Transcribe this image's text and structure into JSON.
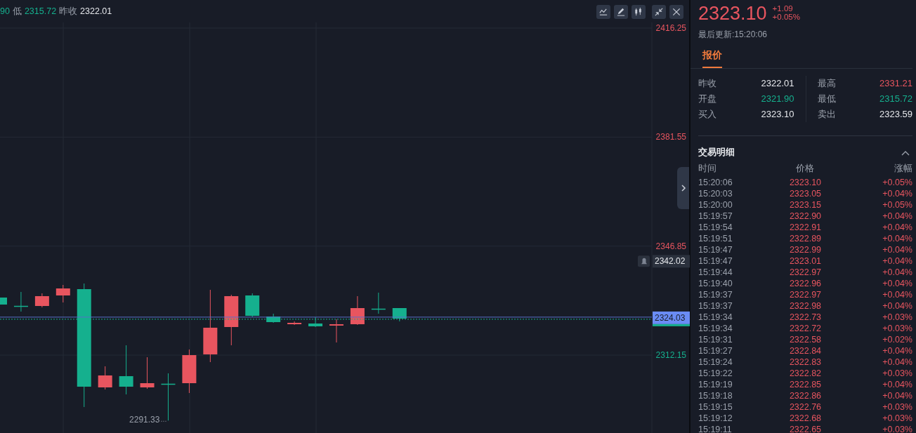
{
  "quote_bar": [
    {
      "text": "90",
      "color": "#15b08e"
    },
    {
      "text": "低",
      "color": "#9aa0ab"
    },
    {
      "text": "2315.72",
      "color": "#15b08e"
    },
    {
      "text": "昨收",
      "color": "#9aa0ab"
    },
    {
      "text": "2322.01",
      "color": "#e6e8ec"
    }
  ],
  "toolbar": [
    {
      "kind": "indicator"
    },
    {
      "kind": "draw"
    },
    {
      "kind": "candles"
    },
    {
      "kind": "shrink"
    },
    {
      "kind": "close"
    }
  ],
  "chart": {
    "axis_labels": [
      {
        "label": "2416.25",
        "color": "#e8555f"
      },
      {
        "label": "2381.55",
        "color": "#e8555f"
      },
      {
        "label": "2346.85",
        "color": "#e8555f"
      },
      {
        "label": "2312.15",
        "color": "#15b08e"
      }
    ],
    "low_label": "2291.33",
    "price_tags": [
      {
        "kind": "alert",
        "label": "2342.02"
      },
      {
        "kind": "current",
        "label": "2324.03"
      }
    ]
  },
  "panel": {
    "price": "2323.10",
    "change": "+1.09",
    "change_percent": "+0.05%",
    "updated": "最后更新:15:20:06",
    "tabs": [
      {
        "label": "报价",
        "selected": true
      }
    ],
    "stats": [
      {
        "label": "昨收",
        "value": "2322.01",
        "color": "#e6e8ec"
      },
      {
        "label": "最高",
        "value": "2331.21",
        "color": "#e8555f"
      },
      {
        "label": "开盘",
        "value": "2321.90",
        "color": "#15b08e"
      },
      {
        "label": "最低",
        "value": "2315.72",
        "color": "#15b08e"
      },
      {
        "label": "买入",
        "value": "2323.10",
        "color": "#e6e8ec"
      },
      {
        "label": "卖出",
        "value": "2323.59",
        "color": "#e6e8ec"
      }
    ],
    "trades_title": "交易明细",
    "trades_expanded": true,
    "trade_columns": [
      "时间",
      "价格",
      "涨幅"
    ],
    "trades": [
      {
        "time": "15:20:06",
        "price": "2323.10",
        "change": "+0.05%"
      },
      {
        "time": "15:20:03",
        "price": "2323.05",
        "change": "+0.04%"
      },
      {
        "time": "15:20:00",
        "price": "2323.15",
        "change": "+0.05%"
      },
      {
        "time": "15:19:57",
        "price": "2322.90",
        "change": "+0.04%"
      },
      {
        "time": "15:19:54",
        "price": "2322.91",
        "change": "+0.04%"
      },
      {
        "time": "15:19:51",
        "price": "2322.89",
        "change": "+0.04%"
      },
      {
        "time": "15:19:47",
        "price": "2322.99",
        "change": "+0.04%"
      },
      {
        "time": "15:19:47",
        "price": "2323.01",
        "change": "+0.04%"
      },
      {
        "time": "15:19:44",
        "price": "2322.97",
        "change": "+0.04%"
      },
      {
        "time": "15:19:40",
        "price": "2322.96",
        "change": "+0.04%"
      },
      {
        "time": "15:19:37",
        "price": "2322.97",
        "change": "+0.04%"
      },
      {
        "time": "15:19:37",
        "price": "2322.98",
        "change": "+0.04%"
      },
      {
        "time": "15:19:34",
        "price": "2322.73",
        "change": "+0.03%"
      },
      {
        "time": "15:19:34",
        "price": "2322.72",
        "change": "+0.03%"
      },
      {
        "time": "15:19:31",
        "price": "2322.58",
        "change": "+0.02%"
      },
      {
        "time": "15:19:27",
        "price": "2322.84",
        "change": "+0.04%"
      },
      {
        "time": "15:19:24",
        "price": "2322.83",
        "change": "+0.04%"
      },
      {
        "time": "15:19:22",
        "price": "2322.82",
        "change": "+0.03%"
      },
      {
        "time": "15:19:19",
        "price": "2322.85",
        "change": "+0.04%"
      },
      {
        "time": "15:19:18",
        "price": "2322.86",
        "change": "+0.04%"
      },
      {
        "time": "15:19:15",
        "price": "2322.76",
        "change": "+0.03%"
      },
      {
        "time": "15:19:12",
        "price": "2322.68",
        "change": "+0.03%"
      },
      {
        "time": "15:19:11",
        "price": "2322.65",
        "change": "+0.03%"
      }
    ]
  }
}
